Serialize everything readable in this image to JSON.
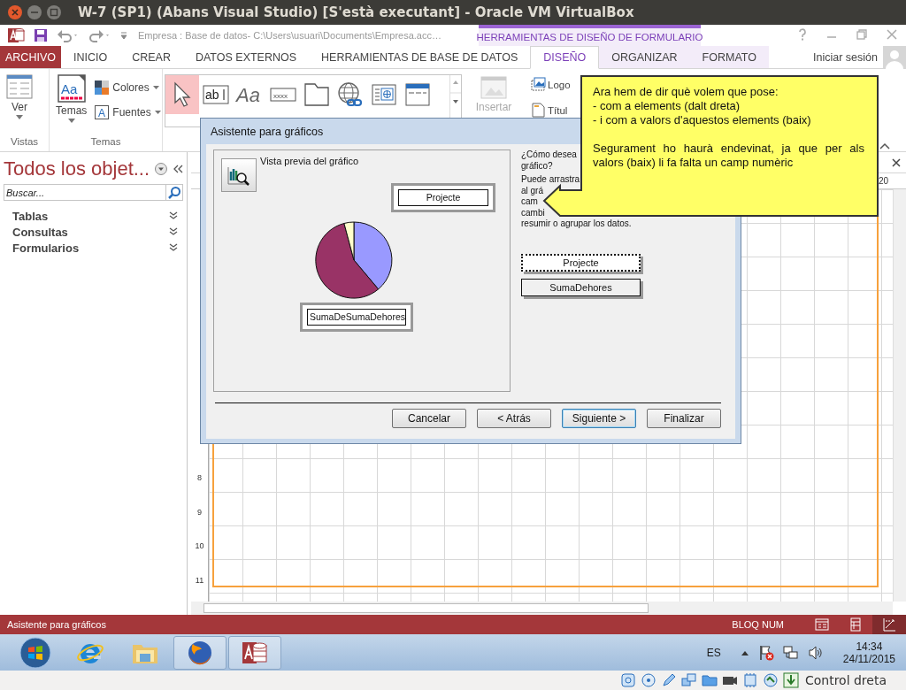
{
  "vm_window": {
    "title": "W-7 (SP1) (Abans Visual Studio) [S'està executant] - Oracle VM VirtualBox"
  },
  "title_bar": {
    "document": "Empresa : Base de datos- C:\\Users\\usuari\\Documents\\Empresa.acc…",
    "context_group": "HERRAMIENTAS DE DISEÑO DE FORMULARIO"
  },
  "tabs": [
    {
      "label": "ARCHIVO",
      "kind": "file",
      "selected": false
    },
    {
      "label": "INICIO",
      "kind": "tab",
      "selected": false
    },
    {
      "label": "CREAR",
      "kind": "tab",
      "selected": false
    },
    {
      "label": "DATOS EXTERNOS",
      "kind": "tab",
      "selected": false
    },
    {
      "label": "HERRAMIENTAS DE BASE DE DATOS",
      "kind": "tab",
      "selected": false
    },
    {
      "label": "DISEÑO",
      "kind": "context",
      "selected": true
    },
    {
      "label": "ORGANIZAR",
      "kind": "context",
      "selected": false
    },
    {
      "label": "FORMATO",
      "kind": "context",
      "selected": false
    }
  ],
  "account": {
    "label": "Iniciar sesión"
  },
  "ribbon": {
    "views": {
      "button": "Ver",
      "group": "Vistas"
    },
    "themes": {
      "glyph": "Aa",
      "button": "Temas",
      "colors": "Colores",
      "fonts_glyph": "A",
      "fonts": "Fuentes",
      "group": "Temas"
    },
    "controls": [
      {
        "kind": "pointer",
        "selected": true
      },
      {
        "kind": "textbox",
        "glyph": "ab",
        "selected": false
      },
      {
        "kind": "label",
        "glyph": "Aa",
        "selected": false
      },
      {
        "kind": "button",
        "glyph": "xxxx",
        "selected": false
      },
      {
        "kind": "tabs",
        "selected": false
      },
      {
        "kind": "hyperlink",
        "selected": false
      },
      {
        "kind": "browser",
        "selected": false
      },
      {
        "kind": "navigation",
        "selected": false
      }
    ],
    "insert": {
      "label": "Insertar",
      "disabled": true
    },
    "header": [
      "Logo",
      "Títul"
    ]
  },
  "navigation_pane": {
    "title": "Todos los objet...",
    "search_placeholder": "Buscar...",
    "groups": [
      "Tablas",
      "Consultas",
      "Formularios"
    ]
  },
  "design_view": {
    "ruler_label": "20",
    "ruler_rows": [
      "8",
      "9",
      "10",
      "11"
    ]
  },
  "dialog": {
    "title": "Asistente para gráficos",
    "preview_label": "Vista previa del gráfico",
    "category_box": "Projecte",
    "value_box": "SumaDeSumaDehores",
    "instructions": [
      "¿Cómo desea",
      "gráfico?",
      "Puede arrastra",
      "al grá",
      "cam",
      "cambi",
      "resumir o agrupar los datos."
    ],
    "fields": [
      {
        "label": "Projecte",
        "selected": true
      },
      {
        "label": "SumaDehores",
        "selected": false
      }
    ],
    "buttons": [
      {
        "label": "Cancelar",
        "default": false
      },
      {
        "label": "< Atrás",
        "default": false
      },
      {
        "label": "Siguiente >",
        "default": true
      },
      {
        "label": "Finalizar",
        "default": false
      }
    ]
  },
  "callout": {
    "lines": [
      "Ara hem de dir què volem que pose:",
      "- com a elements (dalt dreta)",
      "- i com a valors d'aquestos elements (baix)"
    ],
    "note": "Segurament ho haurà endevinat, ja que per als valors (baix) li fa falta un camp numèric"
  },
  "status_bar": {
    "text": "Asistente para gráficos",
    "indicator": "BLOQ NUM",
    "views": [
      {
        "kind": "form",
        "selected": false
      },
      {
        "kind": "layout",
        "selected": false
      },
      {
        "kind": "design",
        "selected": true
      }
    ]
  },
  "taskbar": {
    "apps": [
      {
        "kind": "ie",
        "active": false
      },
      {
        "kind": "explorer",
        "active": false
      },
      {
        "kind": "firefox",
        "active": true
      },
      {
        "kind": "access",
        "active": true
      }
    ],
    "language": "ES",
    "time": "14:34",
    "date": "24/11/2015"
  },
  "vm_status": {
    "host_key": "Control dreta"
  }
}
